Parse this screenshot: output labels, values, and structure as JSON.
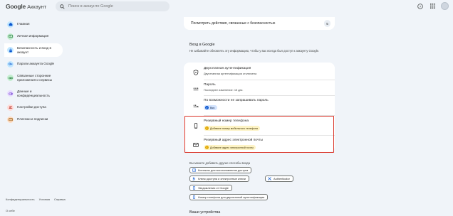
{
  "header": {
    "logo_google": "Google",
    "logo_product": "Аккаунт",
    "search_placeholder": "Поиск в аккаунте Google",
    "icons": [
      "search-icon",
      "help-icon",
      "apps-icon",
      "avatar"
    ]
  },
  "sidebar": {
    "items": [
      {
        "label": "Главная",
        "icon": "home-icon",
        "color": "#c2e7ff"
      },
      {
        "label": "Личная информация",
        "icon": "person-icon",
        "color": "#c4eed0"
      },
      {
        "label": "Безопасность и вход в аккаунт",
        "icon": "lock-icon",
        "color": "#c2e7ff",
        "active": true
      },
      {
        "label": "Пароли аккаунта Google",
        "icon": "key-icon",
        "color": "#c2e7ff"
      },
      {
        "label": "Связанные сторонние приложения и сервисы",
        "icon": "link-icon",
        "color": "#c4eed0"
      },
      {
        "label": "Данные и конфиденциальность",
        "icon": "toggle-icon",
        "color": "#e9ddff"
      },
      {
        "label": "Настройки доступа",
        "icon": "people-icon",
        "color": "#ffdad6"
      },
      {
        "label": "Платежи и подписки",
        "icon": "card-icon",
        "color": "#ffdcc1"
      }
    ],
    "footer_links": [
      "Конфиденциальность",
      "Условия",
      "Справка"
    ],
    "about": "О себе"
  },
  "main": {
    "top_row": {
      "label": "Посмотреть действия, связанные с безопасностью",
      "count": "5"
    },
    "signin": {
      "title": "Вход в Google",
      "description": "Не забывайте обновлять эту информацию, чтобы у вас всегда был доступ к аккаунту Google.",
      "rows": [
        {
          "title": "Двухэтапная аутентификация",
          "subtitle": "Двухэтапная аутентификация отключена",
          "icon": "shield-icon"
        },
        {
          "title": "Пароль",
          "subtitle": "Последнее изменение: 15 дек.",
          "icon": "password-icon"
        },
        {
          "title": "По возможности не запрашивать пароль",
          "badge": "Вкл.",
          "icon": "skip-password-icon"
        },
        {
          "title": "Резервный номер телефона",
          "badge": "Добавьте номер мобильного телефона",
          "icon": "phone-icon"
        },
        {
          "title": "Резервный адрес электронной почты",
          "badge": "Добавьте адрес электронной почты",
          "icon": "mail-icon"
        }
      ]
    },
    "other_methods": {
      "label": "Вы можете добавить другие способы входа",
      "chips": [
        "Контакты для восстановления доступа",
        "Ключи доступа и электронные ключи",
        "Authenticator",
        "Уведомления от Google",
        "Номер телефона для двухэтапной аутентификации"
      ]
    },
    "devices_title": "Ваши устройства"
  },
  "colors": {
    "page_bg": "#f0f4f9",
    "card_bg": "#ffffff",
    "highlight_border": "#d93025",
    "badge_on": "#d3e3fd",
    "badge_warning": "#fdf3c4"
  }
}
